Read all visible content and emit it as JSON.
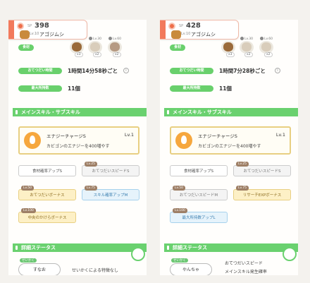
{
  "cards": [
    {
      "sp_label": "SP",
      "sp_value": "398",
      "level": "Lv.10",
      "name": "アゴジムシ",
      "ingredients_label": "食材",
      "ingredient_levels": [
        "Lv.30",
        "Lv.60"
      ],
      "ingredient_qty": [
        "x3",
        "x2",
        "x2"
      ],
      "help_label": "おてつだい時間",
      "help_value": "1時間14分58秒ごと",
      "maxhold_label": "最大所持数",
      "maxhold_value": "11個",
      "section_skills": "メインスキル・サブスキル",
      "main_skill": {
        "name": "エナジーチャージS",
        "level": "Lv.1",
        "desc": "カビゴンのエナジーを400増やす"
      },
      "subskills": [
        {
          "label": "食材確率アップS",
          "lv": ""
        },
        {
          "label": "おてつだいスピードS",
          "lv": "Lv.25"
        },
        {
          "label": "おてつだいボーナス",
          "lv": "Lv.50"
        },
        {
          "label": "スキル確率アップM",
          "lv": "Lv.75"
        },
        {
          "label": "中央のかけらボーナス",
          "lv": "Lv.100"
        }
      ],
      "section_status": "詳細ステータス",
      "nature_badge": "せいかく",
      "nature": "すなお",
      "nature_note": "せいかくによる特徴なし"
    },
    {
      "sp_label": "SP",
      "sp_value": "428",
      "level": "Lv.10",
      "name": "アゴジムシ",
      "ingredients_label": "食材",
      "ingredient_levels": [
        "Lv.30",
        "Lv.60"
      ],
      "ingredient_qty": [
        "x3",
        "x2",
        "x2"
      ],
      "help_label": "おてつだい時間",
      "help_value": "1時間7分28秒ごと",
      "maxhold_label": "最大所持数",
      "maxhold_value": "11個",
      "section_skills": "メインスキル・サブスキル",
      "main_skill": {
        "name": "エナジーチャージS",
        "level": "Lv.1",
        "desc": "カビゴンのエナジーを400増やす"
      },
      "subskills": [
        {
          "label": "食材確率アップS",
          "lv": ""
        },
        {
          "label": "おてつだいスピードS",
          "lv": "Lv.25"
        },
        {
          "label": "おてつだいスピードM",
          "lv": "Lv.50"
        },
        {
          "label": "リサーチEXPボーナス",
          "lv": "Lv.75"
        },
        {
          "label": "最大所持数アップL",
          "lv": "Lv.100"
        }
      ],
      "section_status": "詳細ステータス",
      "nature_badge": "せいかく",
      "nature": "やんちゃ",
      "nature_note": "おてつだいスピード",
      "nature_note2": "メインスキル発生確率"
    }
  ],
  "colors": {
    "accent_green": "#6ad16f",
    "header_stripe": "#f27a5c",
    "gold": "#e8cf82",
    "blue": "#a6d1ec"
  }
}
